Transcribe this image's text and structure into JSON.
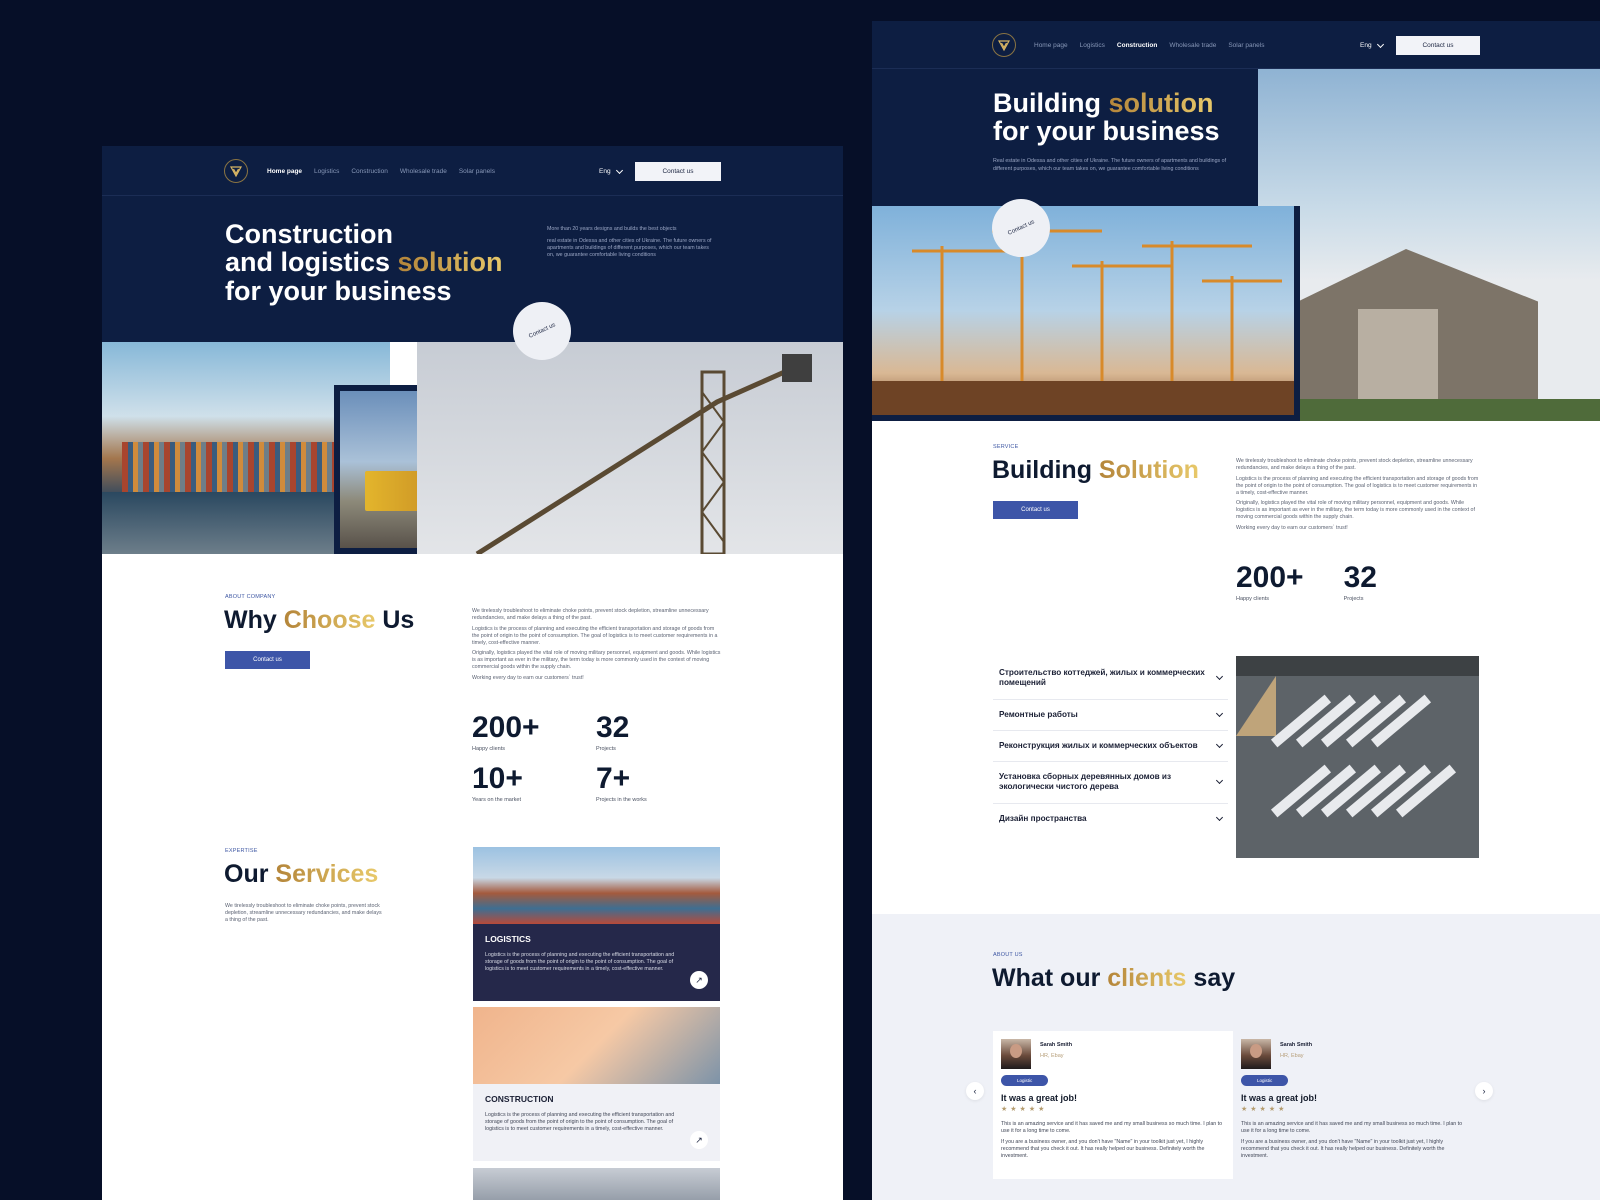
{
  "colors": {
    "navy": "#0d1e42",
    "gold_from": "#b4853a",
    "gold_to": "#e8c96a",
    "accent_blue": "#3d55a8",
    "background": "#060f28"
  },
  "left": {
    "nav": {
      "links": [
        "Home page",
        "Logistics",
        "Construction",
        "Wholesale trade",
        "Solar panels"
      ],
      "active": "Home page",
      "lang": "Eng",
      "cta": "Contact us"
    },
    "hero": {
      "title_line1": "Construction",
      "title_line2a": "and logistics ",
      "title_line2b": "solution",
      "title_line3": "for your business",
      "intro": "More than 20 years designs and builds the best objects",
      "desc": "real estate in Odessa and other cities of Ukraine. The future owners of apartments and buildings of different purposes, which our team takes on, we guarantee comfortable living conditions",
      "circle_cta": "Contact us"
    },
    "about": {
      "eyebrow": "ABOUT COMPANY",
      "title_a": "Why ",
      "title_b": "Choose",
      "title_c": " Us",
      "cta": "Contact us",
      "paragraphs": [
        "We tirelessly troubleshoot to eliminate choke points, prevent stock depletion, streamline unnecessary redundancies, and make delays a thing of the past.",
        "Logistics is the process of planning and executing the efficient transportation and storage of goods from the point of origin to the point of consumption. The goal of logistics is to meet customer requirements in a timely, cost-effective manner.",
        "Originally, logistics played the vital role of moving military personnel, equipment and goods. While logistics is as important as ever in the military, the term today is more commonly used in the context of moving commercial goods within the supply chain.",
        "Working every day to earn our customers` trust!"
      ],
      "stats": [
        {
          "value": "200+",
          "label": "Happy clients"
        },
        {
          "value": "32",
          "label": "Projects"
        },
        {
          "value": "10+",
          "label": "Years on the market"
        },
        {
          "value": "7+",
          "label": "Projects in the works"
        }
      ]
    },
    "services": {
      "eyebrow": "EXPERTISE",
      "title_a": "Our ",
      "title_b": "Services",
      "desc": "We tirelessly troubleshoot to eliminate choke points, prevent stock depletion, streamline unnecessary redundancies, and make delays a thing of the past.",
      "cards": [
        {
          "title": "LOGISTICS",
          "text": "Logistics is the process of planning and executing the efficient transportation and storage of goods from the point of origin to the point of consumption. The goal of logistics is to meet customer requirements in a timely, cost-effective manner.",
          "icon": "arrow-up-right-icon"
        },
        {
          "title": "CONSTRUCTION",
          "text": "Logistics is the process of planning and executing the efficient transportation and storage of goods from the point of origin to the point of consumption. The goal of logistics is to meet customer requirements in a timely, cost-effective manner.",
          "icon": "arrow-up-right-icon"
        }
      ]
    }
  },
  "right": {
    "nav": {
      "links": [
        "Home page",
        "Logistics",
        "Construction",
        "Wholesale trade",
        "Solar panels"
      ],
      "active": "Construction",
      "lang": "Eng",
      "cta": "Contact us"
    },
    "hero": {
      "title_a": "Building ",
      "title_b": "solution",
      "title_line2": "for your business",
      "desc": "Real estate in Odessa and other cities of Ukraine. The future owners of apartments and buildings of different purposes, which our team takes on, we guarantee comfortable living conditions",
      "circle_cta": "Contact us"
    },
    "service": {
      "eyebrow": "SERVICE",
      "title_a": "Building ",
      "title_b": "Solution",
      "cta": "Contact us",
      "paragraphs": [
        "We tirelessly troubleshoot to eliminate choke points, prevent stock depletion, streamline unnecessary redundancies, and make delays a thing of the past.",
        "Logistics is the process of planning and executing the efficient transportation and storage of goods from the point of origin to the point of consumption. The goal of logistics is to meet customer requirements in a timely, cost-effective manner.",
        "Originally, logistics played the vital role of moving military personnel, equipment and goods. While logistics is as important as ever in the military, the term today is more commonly used in the context of moving commercial goods within the supply chain.",
        "Working every day to earn our customers` trust!"
      ],
      "stats": [
        {
          "value": "200+",
          "label": "Happy clients"
        },
        {
          "value": "32",
          "label": "Projects"
        }
      ]
    },
    "accordion": [
      "Строительство коттеджей, жилых и коммерческих помещений",
      "Ремонтные работы",
      "Реконструкция жилых и коммерческих объектов",
      "Установка сборных деревянных домов из экологически чистого дерева",
      "Дизайн пространства"
    ],
    "testimonials": {
      "eyebrow": "ABOUT US",
      "title_a": "What our ",
      "title_b": "clients",
      "title_c": " say",
      "reviews": [
        {
          "name": "Sarah Smith",
          "role": "HR, Ebay",
          "tag": "Logistic",
          "title": "It was a great job!",
          "rating": 5,
          "p1": "This is an amazing service and it has saved me and my small business so much time. I plan to use it for a long time to come.",
          "p2": "If you are a business owner, and you don't have \"Name\" in your toolkit just yet, I highly recommend that you check it out. It has really helped our business. Definitely worth the investment."
        },
        {
          "name": "Sarah Smith",
          "role": "HR, Ebay",
          "tag": "Logistic",
          "title": "It was a great job!",
          "rating": 5,
          "p1": "This is an amazing service and it has saved me and my small business so much time. I plan to use it for a long time to come.",
          "p2": "If you are a business owner, and you don't have \"Name\" in your toolkit just yet, I highly recommend that you check it out. It has really helped our business. Definitely worth the investment."
        }
      ],
      "stars": "★★★★★"
    }
  }
}
